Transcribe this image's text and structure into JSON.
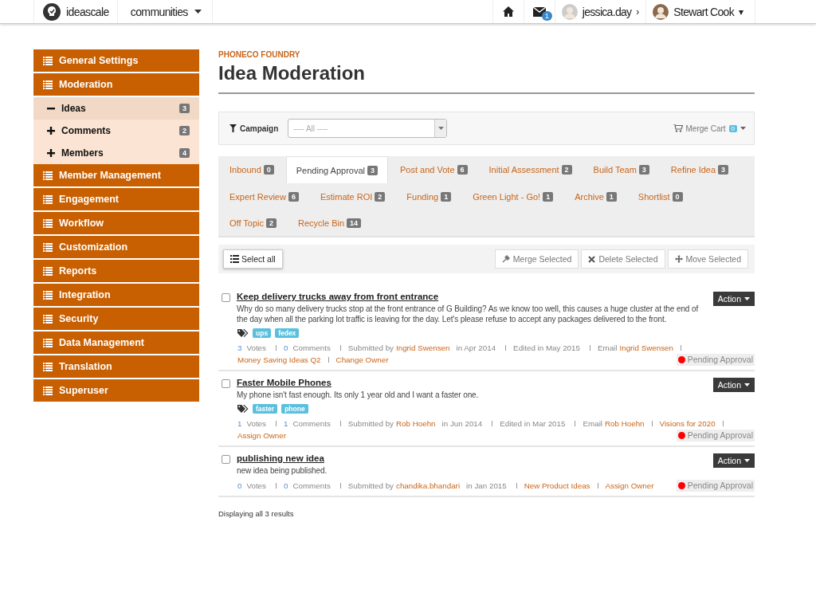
{
  "topbar": {
    "brand": "ideascale",
    "community_menu": "communities",
    "mail_badge": "1",
    "users": [
      {
        "name": "jessica.day",
        "caret": "›"
      },
      {
        "name": "Stewart Cook",
        "caret": "▾"
      }
    ]
  },
  "sidebar": {
    "items": [
      {
        "label": "General Settings"
      },
      {
        "label": "Moderation",
        "children": [
          {
            "label": "Ideas",
            "count": "3",
            "selected": true,
            "expanded": true
          },
          {
            "label": "Comments",
            "count": "2",
            "selected": false,
            "expanded": false
          },
          {
            "label": "Members",
            "count": "4",
            "selected": false,
            "expanded": false
          }
        ]
      },
      {
        "label": "Member Management"
      },
      {
        "label": "Engagement"
      },
      {
        "label": "Workflow"
      },
      {
        "label": "Customization"
      },
      {
        "label": "Reports"
      },
      {
        "label": "Integration"
      },
      {
        "label": "Security"
      },
      {
        "label": "Data Management"
      },
      {
        "label": "Translation"
      },
      {
        "label": "Superuser"
      }
    ]
  },
  "header": {
    "eyebrow": "PHONECO FOUNDRY",
    "title": "Idea Moderation"
  },
  "filter": {
    "label": "Campaign",
    "select_value": "---- All ----",
    "merge_cart": "Merge Cart",
    "merge_cart_count": "0"
  },
  "tabs": [
    {
      "label": "Inbound",
      "count": "0",
      "selected": false
    },
    {
      "label": "Pending Approval",
      "count": "3",
      "selected": true
    },
    {
      "label": "Post and Vote",
      "count": "6",
      "selected": false
    },
    {
      "label": "Initial Assessment",
      "count": "2",
      "selected": false
    },
    {
      "label": "Build Team",
      "count": "3",
      "selected": false
    },
    {
      "label": "Refine Idea",
      "count": "3",
      "selected": false
    },
    {
      "label": "Expert Review",
      "count": "6",
      "selected": false
    },
    {
      "label": "Estimate ROI",
      "count": "2",
      "selected": false
    },
    {
      "label": "Funding",
      "count": "1",
      "selected": false
    },
    {
      "label": "Green Light - Go!",
      "count": "1",
      "selected": false
    },
    {
      "label": "Archive",
      "count": "1",
      "selected": false
    },
    {
      "label": "Shortlist",
      "count": "0",
      "selected": false
    },
    {
      "label": "Off Topic",
      "count": "2",
      "selected": false
    },
    {
      "label": "Recycle Bin",
      "count": "14",
      "selected": false
    }
  ],
  "toolbar": {
    "select_all": "Select all",
    "actions": [
      {
        "label": "Merge Selected",
        "kind": "merge"
      },
      {
        "label": "Delete Selected",
        "kind": "delete"
      },
      {
        "label": "Move Selected",
        "kind": "move"
      }
    ]
  },
  "ideas": {
    "items": [
      {
        "title": "Keep delivery trucks away from front entrance",
        "checked": false,
        "description": "Why do so many delivery trucks stop at the front entrance of G Building? As we know too well, this causes a huge cluster at the end of the day when all the parking lot traffic is leaving for the day. Let's please refuse to accept any packages delivered to the front.",
        "tags": [
          "ups",
          "fedex"
        ],
        "action": "Action",
        "status": "Pending Approval",
        "meta": [
          {
            "kind": "count",
            "value": "3",
            "label": "Votes"
          },
          {
            "kind": "count",
            "value": "0",
            "label": "Comments"
          },
          {
            "kind": "person",
            "label": "Submitted by",
            "link": "Ingrid Swensen",
            "after": "in Apr 2014"
          },
          {
            "kind": "text",
            "label": "Edited in May 2015"
          },
          {
            "kind": "person",
            "label": "Email",
            "link": "Ingrid Swensen"
          },
          {
            "kind": "link",
            "link": "Money Saving Ideas Q2"
          },
          {
            "kind": "link",
            "link": "Change Owner"
          }
        ]
      },
      {
        "title": "Faster Mobile Phones",
        "checked": false,
        "description": "My phone isn't fast enough. Its only 1 year old and I want a faster one.",
        "tags": [
          "faster",
          "phone"
        ],
        "action": "Action",
        "status": "Pending Approval",
        "meta": [
          {
            "kind": "count",
            "value": "1",
            "label": "Votes"
          },
          {
            "kind": "count",
            "value": "1",
            "label": "Comments"
          },
          {
            "kind": "person",
            "label": "Submitted by",
            "link": "Rob Hoehn",
            "after": "in Jun 2014"
          },
          {
            "kind": "text",
            "label": "Edited in Mar 2015"
          },
          {
            "kind": "person",
            "label": "Email",
            "link": "Rob Hoehn"
          },
          {
            "kind": "link",
            "link": "Visions for 2020"
          },
          {
            "kind": "link",
            "link": "Assign Owner"
          }
        ]
      },
      {
        "title": "publishing new idea",
        "checked": false,
        "description": "new idea being published.",
        "action": "Action",
        "status": "Pending Approval",
        "meta": [
          {
            "kind": "count",
            "value": "0",
            "label": "Votes"
          },
          {
            "kind": "count",
            "value": "0",
            "label": "Comments"
          },
          {
            "kind": "person",
            "label": "Submitted by",
            "link": "chandika.bhandari",
            "after": "in Jan 2015"
          },
          {
            "kind": "link",
            "link": "New Product Ideas"
          },
          {
            "kind": "link",
            "link": "Assign Owner"
          }
        ]
      }
    ]
  },
  "footer": "Displaying all 3 results"
}
